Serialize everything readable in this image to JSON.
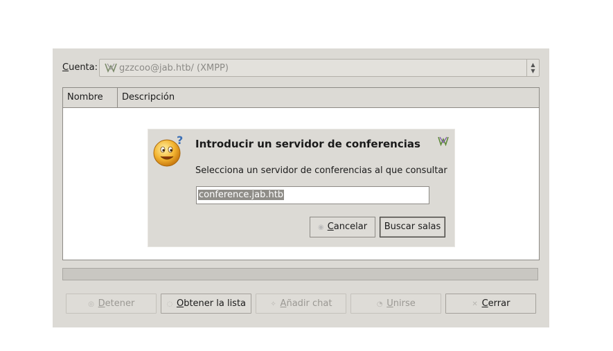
{
  "account": {
    "label_underlined": "C",
    "label_rest": "uenta:",
    "value": "gzzcoo@jab.htb/ (XMPP)",
    "icon": "pidgin-icon"
  },
  "table": {
    "columns": [
      "Nombre",
      "Descripción"
    ]
  },
  "buttons": {
    "stop": {
      "u": "D",
      "rest": "etener"
    },
    "get_list": {
      "u": "O",
      "rest": "btener la lista"
    },
    "add_chat": {
      "u": "A",
      "rest": "ñadir chat"
    },
    "join": {
      "u": "U",
      "rest": "nirse"
    },
    "close": {
      "u": "C",
      "rest": "errar"
    }
  },
  "dialog": {
    "title": "Introducir un servidor de conferencias",
    "subtitle": "Selecciona un servidor de conferencias al que consultar",
    "input_value": "conference.jab.htb",
    "cancel": {
      "u": "C",
      "rest": "ancelar"
    },
    "search": "Buscar salas",
    "icon": "smiley-icon"
  }
}
